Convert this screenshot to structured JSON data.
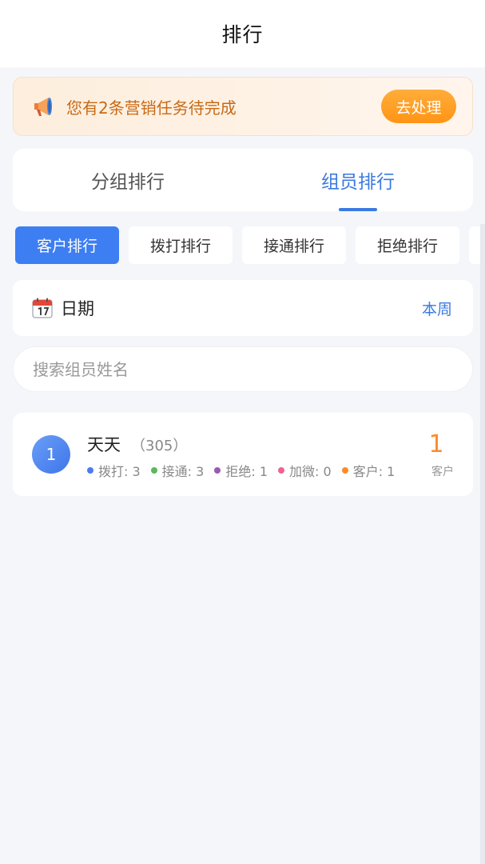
{
  "header": {
    "title": "排行"
  },
  "notice": {
    "icon": "megaphone-icon",
    "text": "您有2条营销任务待完成",
    "action_label": "去处理",
    "accent_color": "#ff9a1f"
  },
  "tabs": [
    {
      "label": "分组排行",
      "active": false
    },
    {
      "label": "组员排行",
      "active": true
    }
  ],
  "chips": [
    {
      "label": "客户排行",
      "active": true
    },
    {
      "label": "拨打排行",
      "active": false
    },
    {
      "label": "接通排行",
      "active": false
    },
    {
      "label": "拒绝排行",
      "active": false
    }
  ],
  "date_filter": {
    "icon": "calendar-icon",
    "label": "日期",
    "value": "本周"
  },
  "search": {
    "placeholder": "搜索组员姓名"
  },
  "ranking": [
    {
      "rank": "1",
      "name": "天天",
      "id": "（305）",
      "stats": [
        {
          "label": "拨打: 3",
          "color": "#4a7cf0"
        },
        {
          "label": "接通: 3",
          "color": "#5bb85a"
        },
        {
          "label": "拒绝: 1",
          "color": "#9b59b6"
        },
        {
          "label": "加微: 0",
          "color": "#f06292"
        },
        {
          "label": "客户: 1",
          "color": "#ff8a2a"
        }
      ],
      "score": "1",
      "score_label": "客户"
    }
  ],
  "colors": {
    "primary": "#3d7ef2",
    "background": "#f4f6fa"
  }
}
